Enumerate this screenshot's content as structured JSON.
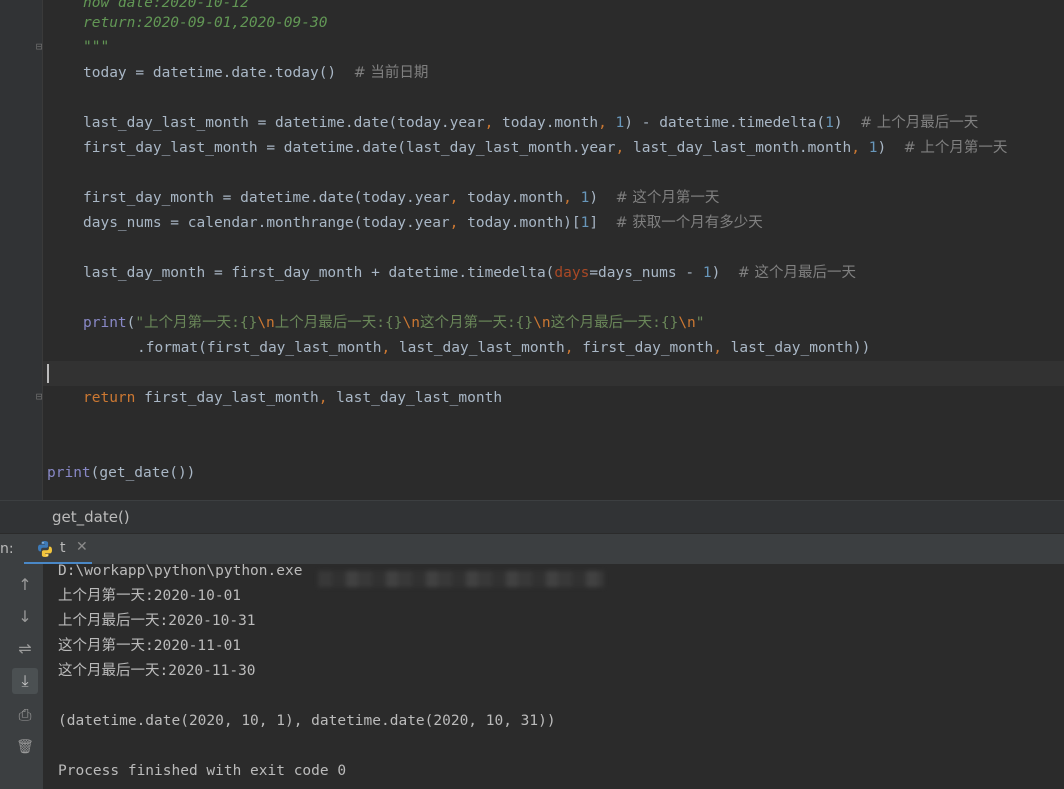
{
  "editor": {
    "doc_line1": "now date:2020-10-12",
    "doc_line2": "return:2020-09-01,2020-09-30",
    "doc_quotes": "\"\"\"",
    "today_code": "today = datetime.date.today()  ",
    "today_comment": "# 当前日期",
    "l1_a": "last_day_last_month = datetime.date(today.year",
    "l1_b": " today.month",
    "l1_num1": "1",
    "l1_c": ") - datetime.timedelta(",
    "l1_num2": "1",
    "l1_d": ")  ",
    "l1_comment": "# 上个月最后一天",
    "l2_a": "first_day_last_month = datetime.date(last_day_last_month.year",
    "l2_b": " last_day_last_month.month",
    "l2_num": "1",
    "l2_c": ")  ",
    "l2_comment": "# 上个月第一天",
    "l3_a": "first_day_month = datetime.date(today.year",
    "l3_b": " today.month",
    "l3_num": "1",
    "l3_c": ")  ",
    "l3_comment": "# 这个月第一天",
    "l4_a": "days_nums = calendar.monthrange(today.year",
    "l4_b": " today.month)[",
    "l4_num": "1",
    "l4_c": "]  ",
    "l4_comment": "# 获取一个月有多少天",
    "l5_a": "last_day_month = first_day_month + datetime.timedelta(",
    "l5_param": "days",
    "l5_b": "=days_nums - ",
    "l5_num": "1",
    "l5_c": ")  ",
    "l5_comment": "# 这个月最后一天",
    "print_kw": "print",
    "print_open": "(",
    "print_str1": "\"上个月第一天:{}",
    "esc1": "\\n",
    "print_str2": "上个月最后一天:{}",
    "esc2": "\\n",
    "print_str3": "这个月第一天:{}",
    "esc3": "\\n",
    "print_str4": "这个月最后一天:{}",
    "esc4": "\\n",
    "print_str5": "\"",
    "format_a": ".format(first_day_last_month",
    "format_b": " last_day_last_month",
    "format_c": " first_day_month",
    "format_d": " last_day_month))",
    "return_kw": "return",
    "return_a": " first_day_last_month",
    "return_b": " last_day_last_month",
    "final_print": "print",
    "final_rest": "(get_date())",
    "comma": ","
  },
  "breadcrumb": {
    "label": "get_date()"
  },
  "run_panel": {
    "label": "n:",
    "tab_name": "t",
    "tab_close": "✕"
  },
  "console": {
    "line1": "D:\\workapp\\python\\python.exe",
    "line2": "上个月第一天:2020-10-01",
    "line3": "上个月最后一天:2020-10-31",
    "line4": "这个月第一天:2020-11-01",
    "line5": "这个月最后一天:2020-11-30",
    "line6": "(datetime.date(2020, 10, 1), datetime.date(2020, 10, 31))",
    "line7": "Process finished with exit code 0"
  },
  "tools": {
    "up": "↑",
    "down": "↓",
    "wrap": "⇌",
    "scroll": "⤓",
    "print": "⎙",
    "trash": "🗑"
  },
  "colors": {
    "editor_bg": "#2b2b2b",
    "keyword": "#cc7832",
    "string": "#6a8759",
    "number": "#6897bb",
    "comment": "#808080",
    "docstring": "#629755",
    "param": "#aa4926"
  }
}
